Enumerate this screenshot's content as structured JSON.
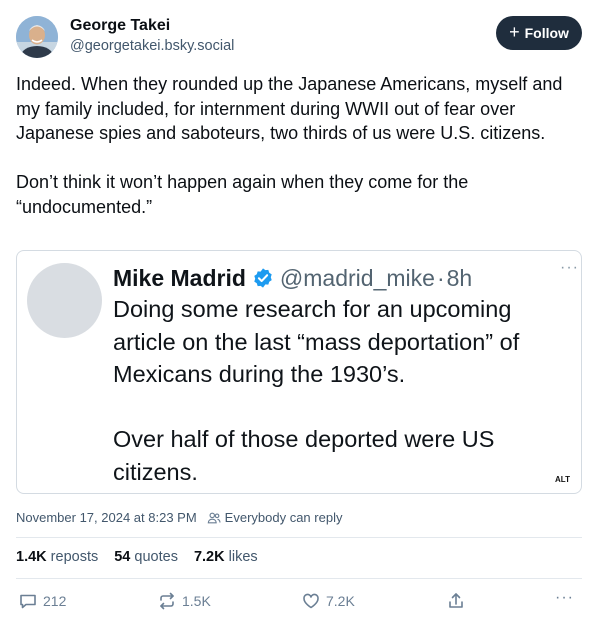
{
  "author": {
    "display_name": "George Takei",
    "handle": "@georgetakei.bsky.social",
    "follow_label": "Follow",
    "follow_icon": "+"
  },
  "post": {
    "text": "Indeed. When they rounded up the Japanese Americans, myself and my family included, for internment during WWII out of fear over Japanese spies and saboteurs, two thirds of us were U.S. citizens.\n\nDon’t think it won’t happen again when they come for the “undocumented.”"
  },
  "embed": {
    "display_name": "Mike Madrid",
    "handle": "@madrid_mike",
    "separator": "·",
    "time": "8h",
    "more_label": "···",
    "text": "Doing some research for an upcoming article on the last “mass deportation” of Mexicans during the 1930’s.\n\nOver half of those deported were US citizens.",
    "alt_label": "ALT",
    "verified_color": "#1d9bf0"
  },
  "meta": {
    "timestamp": "November 17, 2024 at 8:23 PM",
    "reply_setting": "Everybody can reply"
  },
  "stats": {
    "reposts_count": "1.4K",
    "reposts_label": "reposts",
    "quotes_count": "54",
    "quotes_label": "quotes",
    "likes_count": "7.2K",
    "likes_label": "likes"
  },
  "actions": {
    "replies": "212",
    "reposts": "1.5K",
    "likes": "7.2K",
    "more_label": "···"
  },
  "colors": {
    "follow_bg": "#1f2d3d",
    "muted": "#42576c",
    "icon": "#6b7f94",
    "border": "#d4dbe2"
  }
}
